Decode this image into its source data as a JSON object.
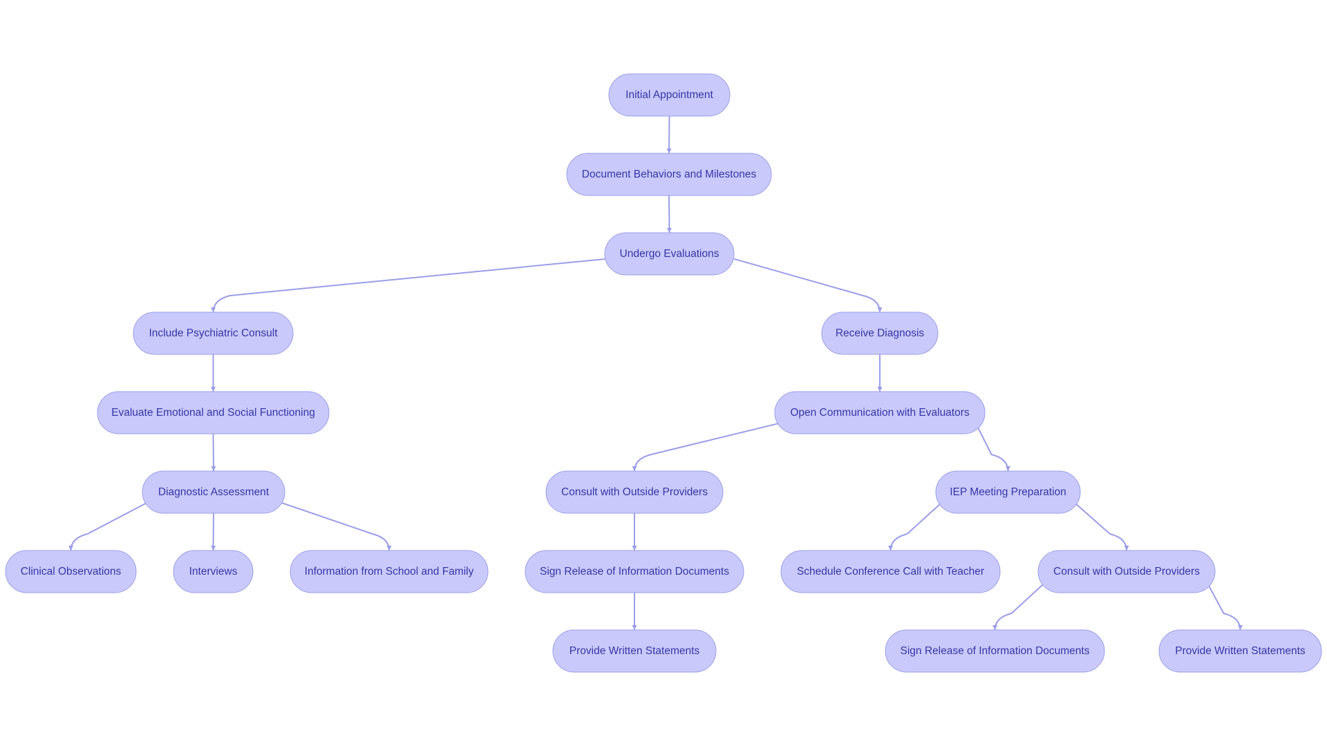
{
  "diagram": {
    "type": "flowchart",
    "direction": "top-down",
    "colors": {
      "node_fill": "#c9cafb",
      "node_stroke": "#9a9de6",
      "label_text": "#3535a6",
      "edge": "#9a9de8",
      "background": "#ffffff"
    },
    "nodes": [
      {
        "id": "n1",
        "label": "Initial Appointment"
      },
      {
        "id": "n2",
        "label": "Document Behaviors and Milestones"
      },
      {
        "id": "n3",
        "label": "Undergo Evaluations"
      },
      {
        "id": "n4",
        "label": "Include Psychiatric Consult"
      },
      {
        "id": "n5",
        "label": "Receive Diagnosis"
      },
      {
        "id": "n6",
        "label": "Evaluate Emotional and Social Functioning"
      },
      {
        "id": "n7",
        "label": "Open Communication with Evaluators"
      },
      {
        "id": "n8",
        "label": "Diagnostic Assessment"
      },
      {
        "id": "n9",
        "label": "Consult with Outside Providers"
      },
      {
        "id": "n10",
        "label": "IEP Meeting Preparation"
      },
      {
        "id": "n11",
        "label": "Clinical Observations"
      },
      {
        "id": "n12",
        "label": "Interviews"
      },
      {
        "id": "n13",
        "label": "Information from School and Family"
      },
      {
        "id": "n14",
        "label": "Sign Release of Information Documents"
      },
      {
        "id": "n15",
        "label": "Schedule Conference Call with Teacher"
      },
      {
        "id": "n16",
        "label": "Consult with Outside Providers"
      },
      {
        "id": "n17",
        "label": "Provide Written Statements"
      },
      {
        "id": "n18",
        "label": "Sign Release of Information Documents"
      },
      {
        "id": "n19",
        "label": "Provide Written Statements"
      }
    ],
    "edges": [
      {
        "from": "n1",
        "to": "n2"
      },
      {
        "from": "n2",
        "to": "n3"
      },
      {
        "from": "n3",
        "to": "n4"
      },
      {
        "from": "n3",
        "to": "n5"
      },
      {
        "from": "n4",
        "to": "n6"
      },
      {
        "from": "n6",
        "to": "n8"
      },
      {
        "from": "n8",
        "to": "n11"
      },
      {
        "from": "n8",
        "to": "n12"
      },
      {
        "from": "n8",
        "to": "n13"
      },
      {
        "from": "n5",
        "to": "n7"
      },
      {
        "from": "n7",
        "to": "n9"
      },
      {
        "from": "n7",
        "to": "n10"
      },
      {
        "from": "n9",
        "to": "n14"
      },
      {
        "from": "n14",
        "to": "n17"
      },
      {
        "from": "n10",
        "to": "n15"
      },
      {
        "from": "n10",
        "to": "n16"
      },
      {
        "from": "n16",
        "to": "n18"
      },
      {
        "from": "n16",
        "to": "n19"
      }
    ]
  }
}
